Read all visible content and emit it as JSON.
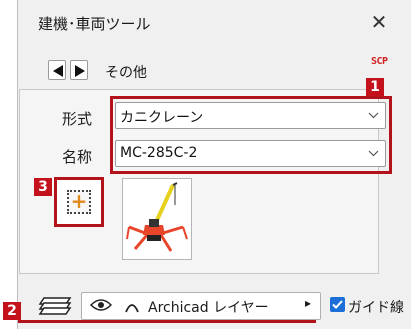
{
  "window": {
    "title": "建機･車両ツール",
    "close_glyph": "✕"
  },
  "nav": {
    "prev_icon": "triangle-left-icon",
    "next_icon": "triangle-right-icon",
    "label": "その他",
    "badge": "SCP"
  },
  "fields": [
    {
      "label": "形式",
      "value": "カニクレーン"
    },
    {
      "label": "名称",
      "value": "MC-285C-2"
    }
  ],
  "markers": {
    "m1": "1",
    "m2": "2",
    "m3": "3"
  },
  "add_button": {
    "glyph": "+"
  },
  "layer": {
    "label": "Archicad レイヤー",
    "arrow": "▸"
  },
  "guide_checkbox": {
    "label": "ガイド線",
    "checked": true
  },
  "colors": {
    "annotation_red": "#b3121b",
    "checkbox_blue": "#1b6fd6",
    "crane_orange": "#e8452a",
    "boom_yellow": "#e6d21e"
  }
}
